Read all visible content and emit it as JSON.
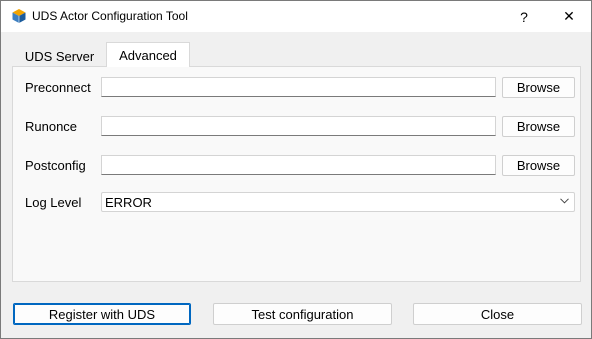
{
  "window": {
    "title": "UDS Actor Configuration Tool",
    "help_label": "?",
    "close_label": "✕"
  },
  "tabs": [
    {
      "label": "UDS Server",
      "active": false
    },
    {
      "label": "Advanced",
      "active": true
    }
  ],
  "advanced": {
    "preconnect": {
      "label": "Preconnect",
      "value": "",
      "browse_label": "Browse"
    },
    "runonce": {
      "label": "Runonce",
      "value": "",
      "browse_label": "Browse"
    },
    "postconfig": {
      "label": "Postconfig",
      "value": "",
      "browse_label": "Browse"
    },
    "log_level": {
      "label": "Log Level",
      "selected": "ERROR"
    }
  },
  "buttons": {
    "register": "Register with UDS",
    "test": "Test configuration",
    "close": "Close"
  },
  "colors": {
    "accent": "#0067c0",
    "window_bg": "#f0f0f0",
    "panel_bg": "#f9f9f9"
  },
  "icons": {
    "app": "uds-logo-icon",
    "dropdown": "chevron-down-icon"
  }
}
